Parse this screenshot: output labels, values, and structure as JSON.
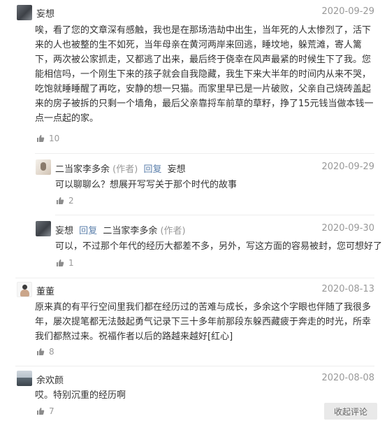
{
  "comments": [
    {
      "author": "妄想",
      "date": "2020-09-29",
      "text": "唉，看了您的文章深有感触，我也是在那场浩劫中出生，当年死的人太惨烈了，活下来的人也被整的生不如死，当年母亲在黄河两岸来回逃，睡坟地，躲荒滩，寄人篱下，两次被公家抓走，又都逃了出来，最后终于侥幸在风声最紧的时候生下了我。您能相信吗，一个刚生下来的孩子就会自我隐藏，我生下来大半年的时间内从来不哭，吃饱就睡睡醒了再吃，安静的想一只猫。而家里早已是一片破败，父亲自己烧砖盖起来的房子被拆的只剩一个墙角，最后父亲靠捋车前草的草籽，挣了15元钱当做本钱一点一点起的家。",
      "likes": "10",
      "replies": [
        {
          "author": "二当家李多余",
          "author_tag": "(作者)",
          "reply_word": "回复",
          "reply_to": "妄想",
          "reply_to_tag": "",
          "date": "2020-09-29",
          "text": "可以聊聊么？想展开写写关于那个时代的故事",
          "likes": "2"
        },
        {
          "author": "妄想",
          "author_tag": "",
          "reply_word": "回复",
          "reply_to": "二当家李多余",
          "reply_to_tag": "(作者)",
          "date": "2020-09-30",
          "text": "可以，不过那个年代的经历大都差不多，另外，写这方面的容易被封，您可想好了",
          "likes": "1"
        }
      ]
    },
    {
      "author": "董董",
      "date": "2020-08-13",
      "text": "原来真的有平行空间里我们都在经历过的苦难与成长，多余这个字眼也伴随了我很多年，屡次提笔都无法鼓起勇气记录下三十多年前那段东躲西藏疲于奔走的时光，所幸我们都熬过来。祝福作者以后的路越来越好[红心]",
      "likes": "8"
    },
    {
      "author": "余欢颜",
      "date": "2020-08-08",
      "text": "哎。特别沉重的经历啊",
      "likes": "7"
    }
  ],
  "collapse_label": "收起评论",
  "colors": {
    "accent": "#5b7fab",
    "muted": "#999999",
    "text": "#333333"
  }
}
